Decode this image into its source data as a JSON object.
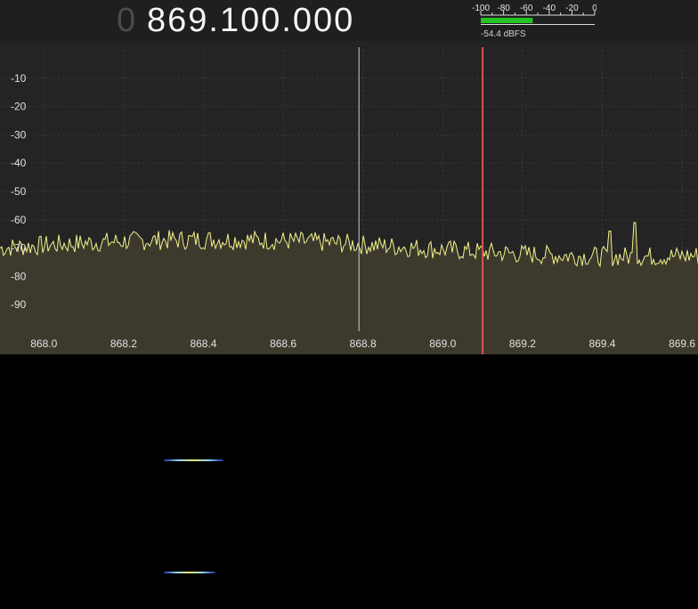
{
  "frequency": {
    "leading_digit": "0",
    "value": "869.100.000"
  },
  "smeter": {
    "scale_labels": [
      "-100",
      "-80",
      "-60",
      "-40",
      "-20",
      "0"
    ],
    "scale_min": -100,
    "scale_max": 0,
    "level_dbfs": -54.4,
    "readout": "-54.4 dBFS",
    "bar_color": "#22c422"
  },
  "spectrum": {
    "y_ticks": [
      -10,
      -20,
      -30,
      -40,
      -50,
      -60,
      -70,
      -80,
      -90
    ],
    "y_range": [
      -100,
      0
    ],
    "x_ticks": [
      868.0,
      868.2,
      868.4,
      868.6,
      868.8,
      869.0,
      869.2,
      869.4,
      869.6
    ],
    "x_tick_labels": [
      "868.0",
      "868.2",
      "868.4",
      "868.6",
      "868.8",
      "869.0",
      "869.2",
      "869.4",
      "869.6"
    ],
    "x_range": [
      867.89,
      869.64
    ],
    "grid": true,
    "noise_floor_db": -70,
    "peaks": [
      {
        "freq": 869.48,
        "db": -61
      },
      {
        "freq": 869.42,
        "db": -64
      }
    ],
    "marker_freq": 868.79,
    "marker_color": "#c8c8e6",
    "tuned_freq": 869.1,
    "tuned_color": "#e05050",
    "trace_color": "#f2f28a",
    "fill_color": "#3d3a2d"
  },
  "waterfall": {
    "traces": [
      {
        "start_freq": 868.3,
        "end_freq": 868.45,
        "color": "#8fd6ff"
      },
      {
        "start_freq": 868.3,
        "end_freq": 868.43,
        "color": "#8fd6ff"
      }
    ]
  }
}
